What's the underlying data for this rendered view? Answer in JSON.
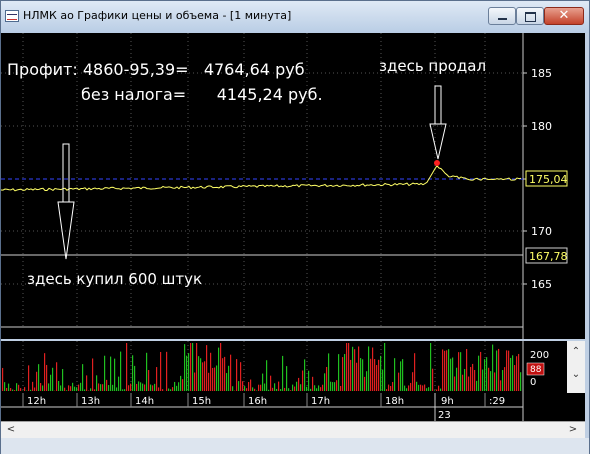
{
  "window": {
    "title": "НЛМК ао Графики цены и объема - [1 минута]"
  },
  "colors": {
    "price_line": "#ffff66",
    "level_line": "#3344ff",
    "buy_level": "#d0d0d0",
    "sell_marker": "#ff2020",
    "vol_up": "#20c020",
    "vol_down": "#e02020",
    "grid": "#6a6a6a"
  },
  "icons": {
    "minimize": "minimize-icon",
    "maximize": "maximize-icon",
    "close": "close-icon",
    "scroll_up": "chevron-up-icon",
    "scroll_down": "chevron-down-icon",
    "scroll_left": "chevron-left-icon",
    "scroll_right": "chevron-right-icon"
  },
  "annotations": {
    "profit_line": "Профит: 4860-95,39=   4764,64 руб",
    "no_tax_line": "без налога=      4145,24 руб.",
    "sold_label": "здесь продал",
    "bought_label": "здесь купил 600 штук"
  },
  "price_axis": {
    "ticks": [
      "185",
      "180",
      "175",
      "170",
      "165"
    ]
  },
  "price_tags": {
    "current": "175,04",
    "buy": "167,78"
  },
  "volume_axis": {
    "ticks": [
      "200",
      "0"
    ],
    "red_tag": "88"
  },
  "time_axis": {
    "labels": [
      "12h",
      "13h",
      "14h",
      "15h",
      "16h",
      "17h",
      "18h",
      "9h",
      ":29"
    ],
    "date": "23"
  },
  "scroll": {
    "up": "⌃",
    "down": "⌄",
    "left": "<",
    "right": ">"
  },
  "chart_data": {
    "type": "line",
    "price_range": [
      162,
      190
    ],
    "current_price": 175.04,
    "buy_price": 167.78,
    "sell_peak": 176.2
  }
}
